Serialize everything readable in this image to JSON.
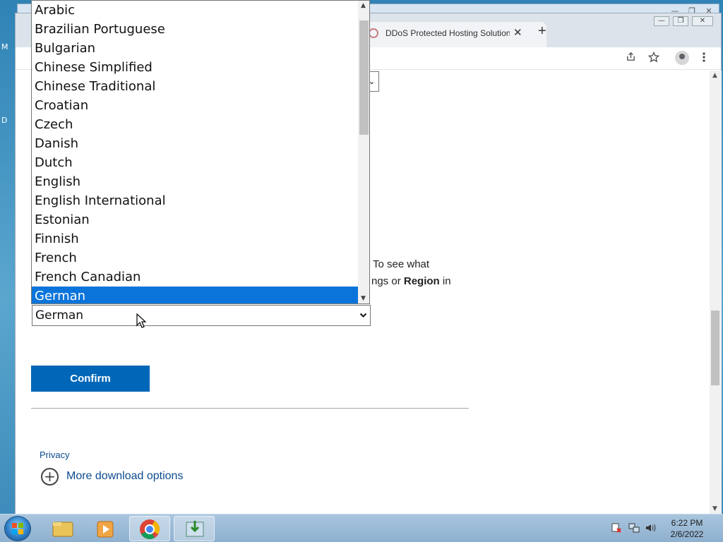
{
  "desktop": {
    "frag1": "M",
    "frag2": "D"
  },
  "browser": {
    "tab": {
      "title": "DDoS Protected Hosting Solution",
      "close": "✕"
    },
    "new_tab": "+",
    "window_controls": {
      "minimize": "—",
      "maximize": "❐",
      "close": "✕"
    }
  },
  "page": {
    "select_stub_arrow": "⌄",
    "partial_line1": "To see what",
    "partial_line2_prefix": "ngs or ",
    "partial_line2_bold": "Region",
    "partial_line2_suffix": " in",
    "language_select": {
      "value": "German",
      "arrow": "⌄"
    },
    "confirm_label": "Confirm",
    "privacy_label": "Privacy",
    "more_options": {
      "icon": "+",
      "label": "More download options"
    }
  },
  "dropdown": {
    "items": [
      "Arabic",
      "Brazilian Portuguese",
      "Bulgarian",
      "Chinese Simplified",
      "Chinese Traditional",
      "Croatian",
      "Czech",
      "Danish",
      "Dutch",
      "English",
      "English International",
      "Estonian",
      "Finnish",
      "French",
      "French Canadian",
      "German"
    ],
    "selected": "German",
    "scroll_up": "▲",
    "scroll_down": "▼"
  },
  "taskbar": {
    "clock_time": "6:22 PM",
    "clock_date": "2/6/2022"
  },
  "colors": {
    "selected_item": "#0a74da",
    "confirm_button": "#0067b8",
    "link": "#0b4b8f"
  }
}
